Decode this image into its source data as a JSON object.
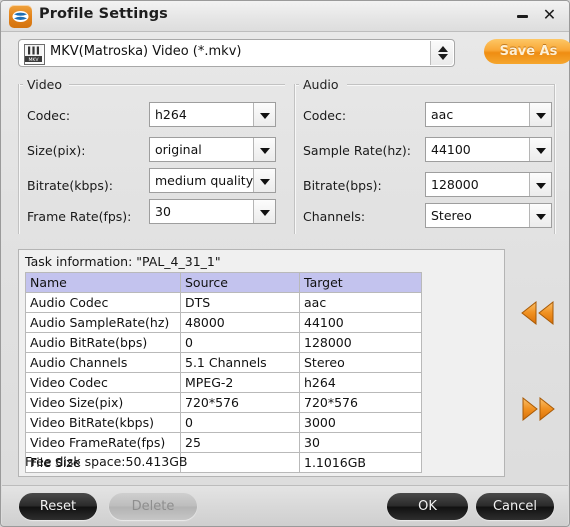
{
  "window": {
    "title": "Profile Settings",
    "app_icon": "bluray-disc-icon",
    "minimize_label": "",
    "close_label": "✕"
  },
  "profile": {
    "icon": "mkv-file-icon",
    "selected": "MKV(Matroska) Video (*.mkv)",
    "save_as_label": "Save As"
  },
  "video": {
    "group_label": "Video",
    "fields": [
      {
        "label": "Codec:",
        "value": "h264"
      },
      {
        "label": "Size(pix):",
        "value": "original"
      },
      {
        "label": "Bitrate(kbps):",
        "value": "medium quality"
      },
      {
        "label": "Frame Rate(fps):",
        "value": "30"
      }
    ]
  },
  "audio": {
    "group_label": "Audio",
    "fields": [
      {
        "label": "Codec:",
        "value": "aac"
      },
      {
        "label": "Sample Rate(hz):",
        "value": "44100"
      },
      {
        "label": "Bitrate(bps):",
        "value": "128000"
      },
      {
        "label": "Channels:",
        "value": "Stereo"
      }
    ]
  },
  "task": {
    "title": "Task information: \"PAL_4_31_1\"",
    "columns": [
      "Name",
      "Source",
      "Target"
    ],
    "rows": [
      {
        "name": "Audio Codec",
        "source": "DTS",
        "target": "aac"
      },
      {
        "name": "Audio SampleRate(hz)",
        "source": "48000",
        "target": "44100"
      },
      {
        "name": "Audio BitRate(bps)",
        "source": "0",
        "target": "128000"
      },
      {
        "name": "Audio Channels",
        "source": "5.1 Channels",
        "target": "Stereo"
      },
      {
        "name": "Video Codec",
        "source": "MPEG-2",
        "target": "h264"
      },
      {
        "name": "Video Size(pix)",
        "source": "720*576",
        "target": "720*576"
      },
      {
        "name": "Video BitRate(kbps)",
        "source": "0",
        "target": "3000"
      },
      {
        "name": "Video FrameRate(fps)",
        "source": "25",
        "target": "30"
      },
      {
        "name": "File Size",
        "source": "",
        "target": "1.1016GB"
      }
    ],
    "disk_space": "Free disk space:50.413GB"
  },
  "nav": {
    "prev_icon": "rewind-double-arrow-icon",
    "next_icon": "forward-double-arrow-icon"
  },
  "footer": {
    "reset_label": "Reset",
    "delete_label": "Delete",
    "ok_label": "OK",
    "cancel_label": "Cancel"
  },
  "colors": {
    "accent_orange": "#ef8d12",
    "table_header": "#c3c3ee",
    "window_bg": "#e2e2e2"
  }
}
